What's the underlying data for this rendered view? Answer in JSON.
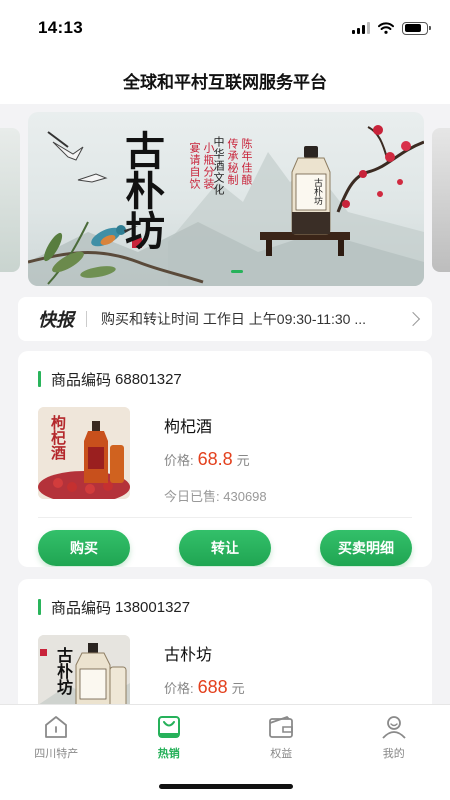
{
  "status_bar": {
    "time": "14:13"
  },
  "header": {
    "title": "全球和平村互联网服务平台"
  },
  "banner": {
    "brand": "古朴坊",
    "slogan_lines": [
      "中华酒文化",
      "传承秘制",
      "陈年佳酿",
      "宴请自饮",
      "小瓶分装"
    ],
    "bottle_label": "古朴坊"
  },
  "news": {
    "label": "快报",
    "text": "购买和转让时间 工作日 上午09:30-11:30 ..."
  },
  "products": [
    {
      "code_label": "商品编码",
      "code": "68801327",
      "name": "枸杞酒",
      "price_label": "价格:",
      "price": "68.8",
      "unit": "元",
      "sold_label": "今日已售:",
      "sold": "430698",
      "thumb_text": "枸杞酒",
      "buttons": {
        "buy": "购买",
        "transfer": "转让",
        "detail": "买卖明细"
      }
    },
    {
      "code_label": "商品编码",
      "code": "138001327",
      "name": "古朴坊",
      "price_label": "价格:",
      "price": "688",
      "unit": "元",
      "thumb_text": "古朴坊"
    }
  ],
  "tabs": [
    {
      "label": "四川特产",
      "icon": "home-icon",
      "active": false
    },
    {
      "label": "热销",
      "icon": "shopping-bag-icon",
      "active": true
    },
    {
      "label": "权益",
      "icon": "wallet-icon",
      "active": false
    },
    {
      "label": "我的",
      "icon": "user-icon",
      "active": false
    }
  ],
  "colors": {
    "accent": "#26b15a",
    "price": "#e3401d"
  }
}
